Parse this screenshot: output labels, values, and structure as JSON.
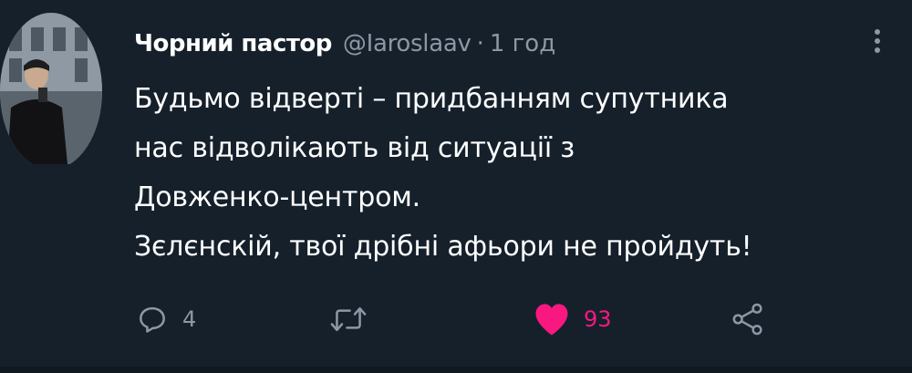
{
  "user": {
    "display_name": "Чорний пастор",
    "handle": "@Iaroslaav",
    "separator": "·",
    "time": "1 год",
    "avatar_icon": "profile-photo"
  },
  "tweet": {
    "lines": [
      "Будьмо відверті – придбанням супутника",
      "нас відволікають від ситуації з",
      "Довженко-центром.",
      "Зєлєнскій, твої дрібні афьори не пройдуть!"
    ]
  },
  "actions": {
    "reply": {
      "icon": "reply-icon",
      "count": "4"
    },
    "retweet": {
      "icon": "retweet-icon",
      "count": ""
    },
    "like": {
      "icon": "heart-icon",
      "count": "93",
      "liked": true
    },
    "share": {
      "icon": "share-icon"
    }
  },
  "colors": {
    "background": "#15202b",
    "text": "#ffffff",
    "muted": "#8b98a5",
    "like": "#f91880"
  }
}
